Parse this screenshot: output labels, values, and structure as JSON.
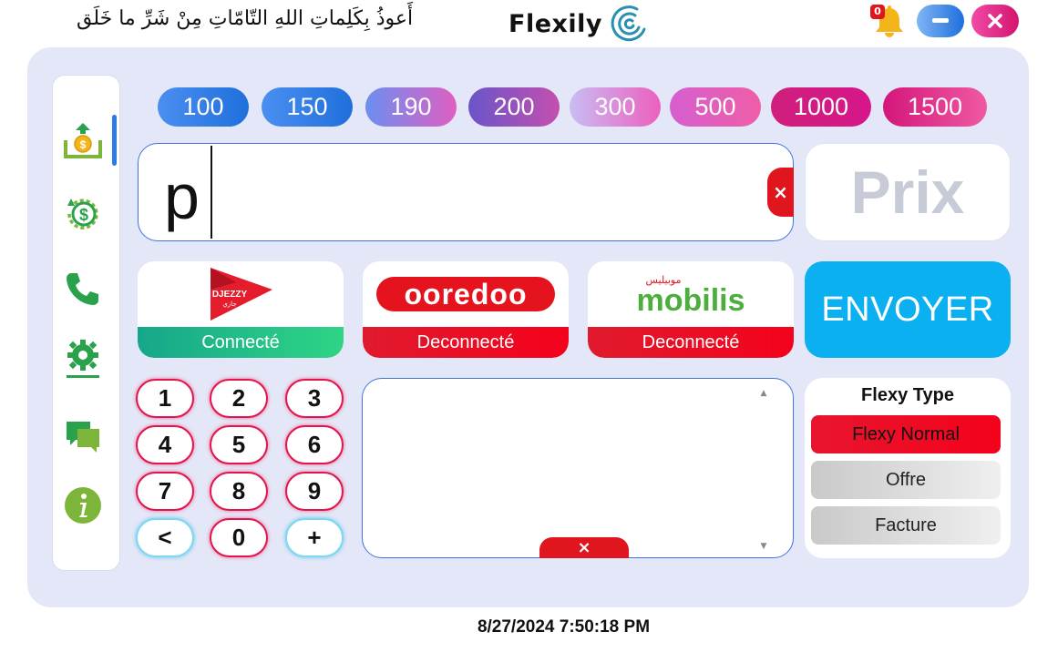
{
  "header": {
    "supplication": "أَعوذُ بِكَلِماتِ اللهِ التّامّاتِ مِنْ شَرِّ ما خَلَق",
    "app_name": "Flexily",
    "notification_count": "0",
    "minimize_icon": "minus-icon",
    "close_icon": "close-icon"
  },
  "sidebar": {
    "items": [
      {
        "name": "money-upload-icon"
      },
      {
        "name": "refund-cycle-icon"
      },
      {
        "name": "phone-icon"
      },
      {
        "name": "settings-icon"
      },
      {
        "name": "chat-icon"
      },
      {
        "name": "info-icon"
      }
    ]
  },
  "amounts": [
    "100",
    "150",
    "190",
    "200",
    "300",
    "500",
    "1000",
    "1500"
  ],
  "phone_input": {
    "value": "p",
    "clear_label": "×"
  },
  "price": {
    "placeholder": "Prix"
  },
  "operators": [
    {
      "name": "DJEZZY",
      "subtitle": "جازي",
      "status": "Connecté",
      "connected": true
    },
    {
      "name": "ooredoo",
      "status": "Deconnecté",
      "connected": false
    },
    {
      "name": "mobilis",
      "subtitle": "موبيليس",
      "status": "Deconnecté",
      "connected": false
    }
  ],
  "send_button": "ENVOYER",
  "keypad": [
    "1",
    "2",
    "3",
    "4",
    "5",
    "6",
    "7",
    "8",
    "9",
    "<",
    "0",
    "+"
  ],
  "log": {
    "clear_label": "×"
  },
  "flexy_type": {
    "title": "Flexy Type",
    "options": [
      "Flexy Normal",
      "Offre",
      "Facture"
    ],
    "selected": "Flexy Normal"
  },
  "status_bar": {
    "datetime": "8/27/2024 7:50:18 PM"
  },
  "colors": {
    "accent_blue": "#1f6fdc",
    "accent_pink": "#d4146e",
    "connected_green": "#2fd486",
    "disconnected_red": "#f4021b",
    "send_cyan": "#0ab0ef"
  }
}
